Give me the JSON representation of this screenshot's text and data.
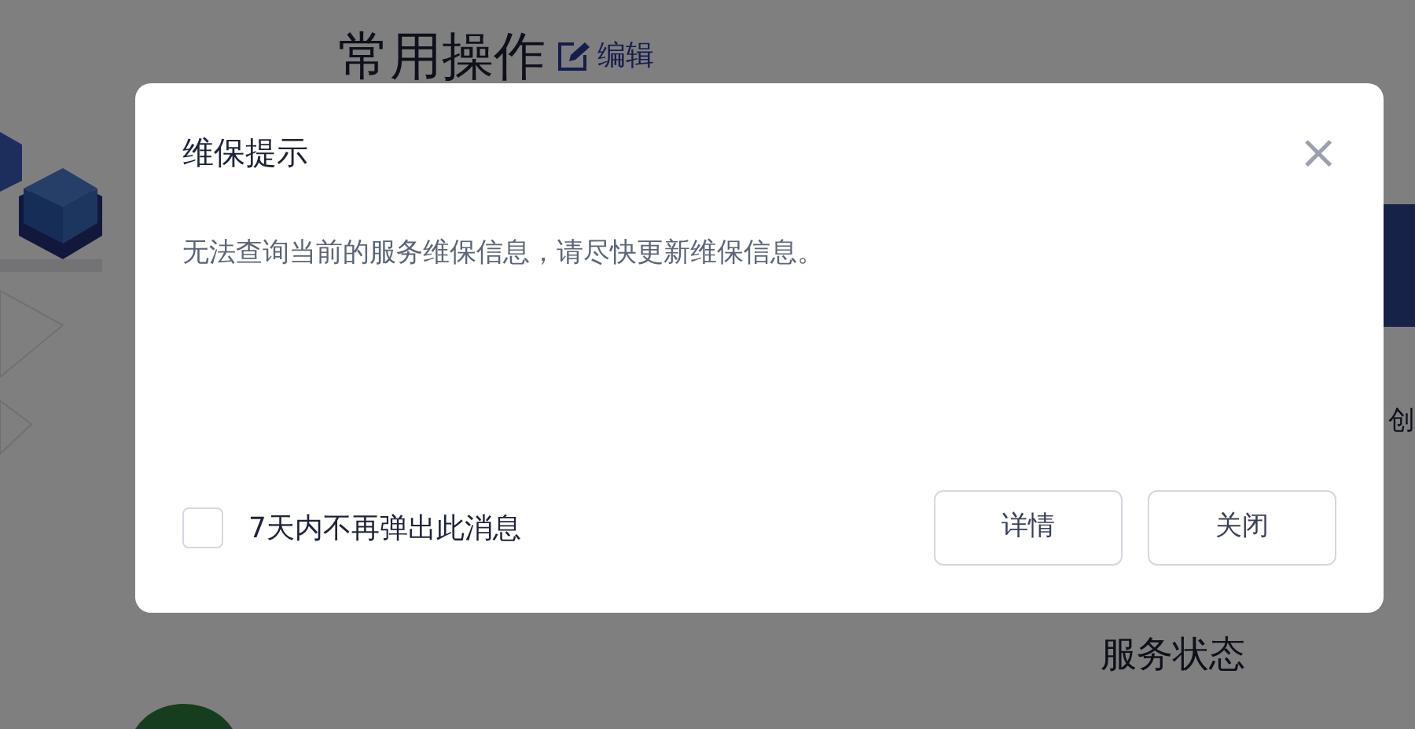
{
  "background": {
    "heading": "常用操作",
    "edit_link": "编辑",
    "side_label": "创",
    "section_title": "服务状态"
  },
  "dialog": {
    "title": "维保提示",
    "close": "×",
    "message": "无法查询当前的服务维保信息，请尽快更新维保信息。",
    "checkbox": {
      "label": "7天内不再弹出此消息",
      "checked": false
    },
    "buttons": [
      {
        "label": "详情"
      },
      {
        "label": "关闭"
      }
    ]
  }
}
